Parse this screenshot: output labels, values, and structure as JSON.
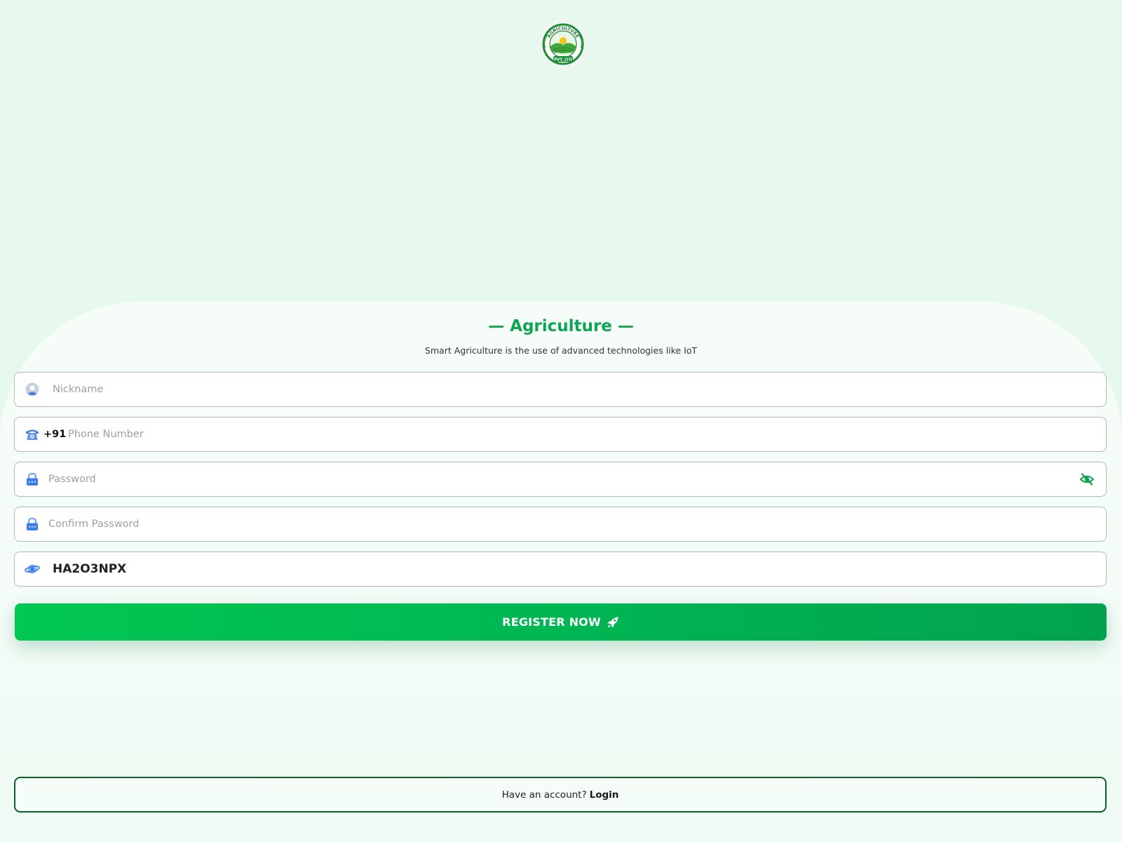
{
  "brand": {
    "logo_icon": "agriculture-logo-icon",
    "logo_top_text": "AGRICULTURE",
    "logo_bottom_text": "PVT. LTD",
    "primary_color": "#0ea552",
    "button_color": "#00b653"
  },
  "header": {
    "title": "— Agriculture —",
    "subtitle": "Smart Agriculture is the use of advanced technologies like IoT"
  },
  "form": {
    "nickname": {
      "placeholder": "Nickname",
      "value": "",
      "icon": "user-avatar-icon"
    },
    "phone": {
      "prefix": "+91",
      "placeholder": "Phone Number",
      "value": "",
      "icon": "telephone-icon"
    },
    "password": {
      "placeholder": "Password",
      "value": "",
      "icon": "lock-icon",
      "toggle_icon": "eye-slash-icon"
    },
    "confirm_password": {
      "placeholder": "Confirm Password",
      "value": "",
      "icon": "lock-icon"
    },
    "invite_code": {
      "placeholder": "",
      "value": "HA2O3NPX",
      "icon": "planet-icon"
    }
  },
  "register_button": {
    "label": "REGISTER NOW",
    "icon": "rocket-icon"
  },
  "footer": {
    "text": "Have an account?",
    "link": "Login"
  }
}
